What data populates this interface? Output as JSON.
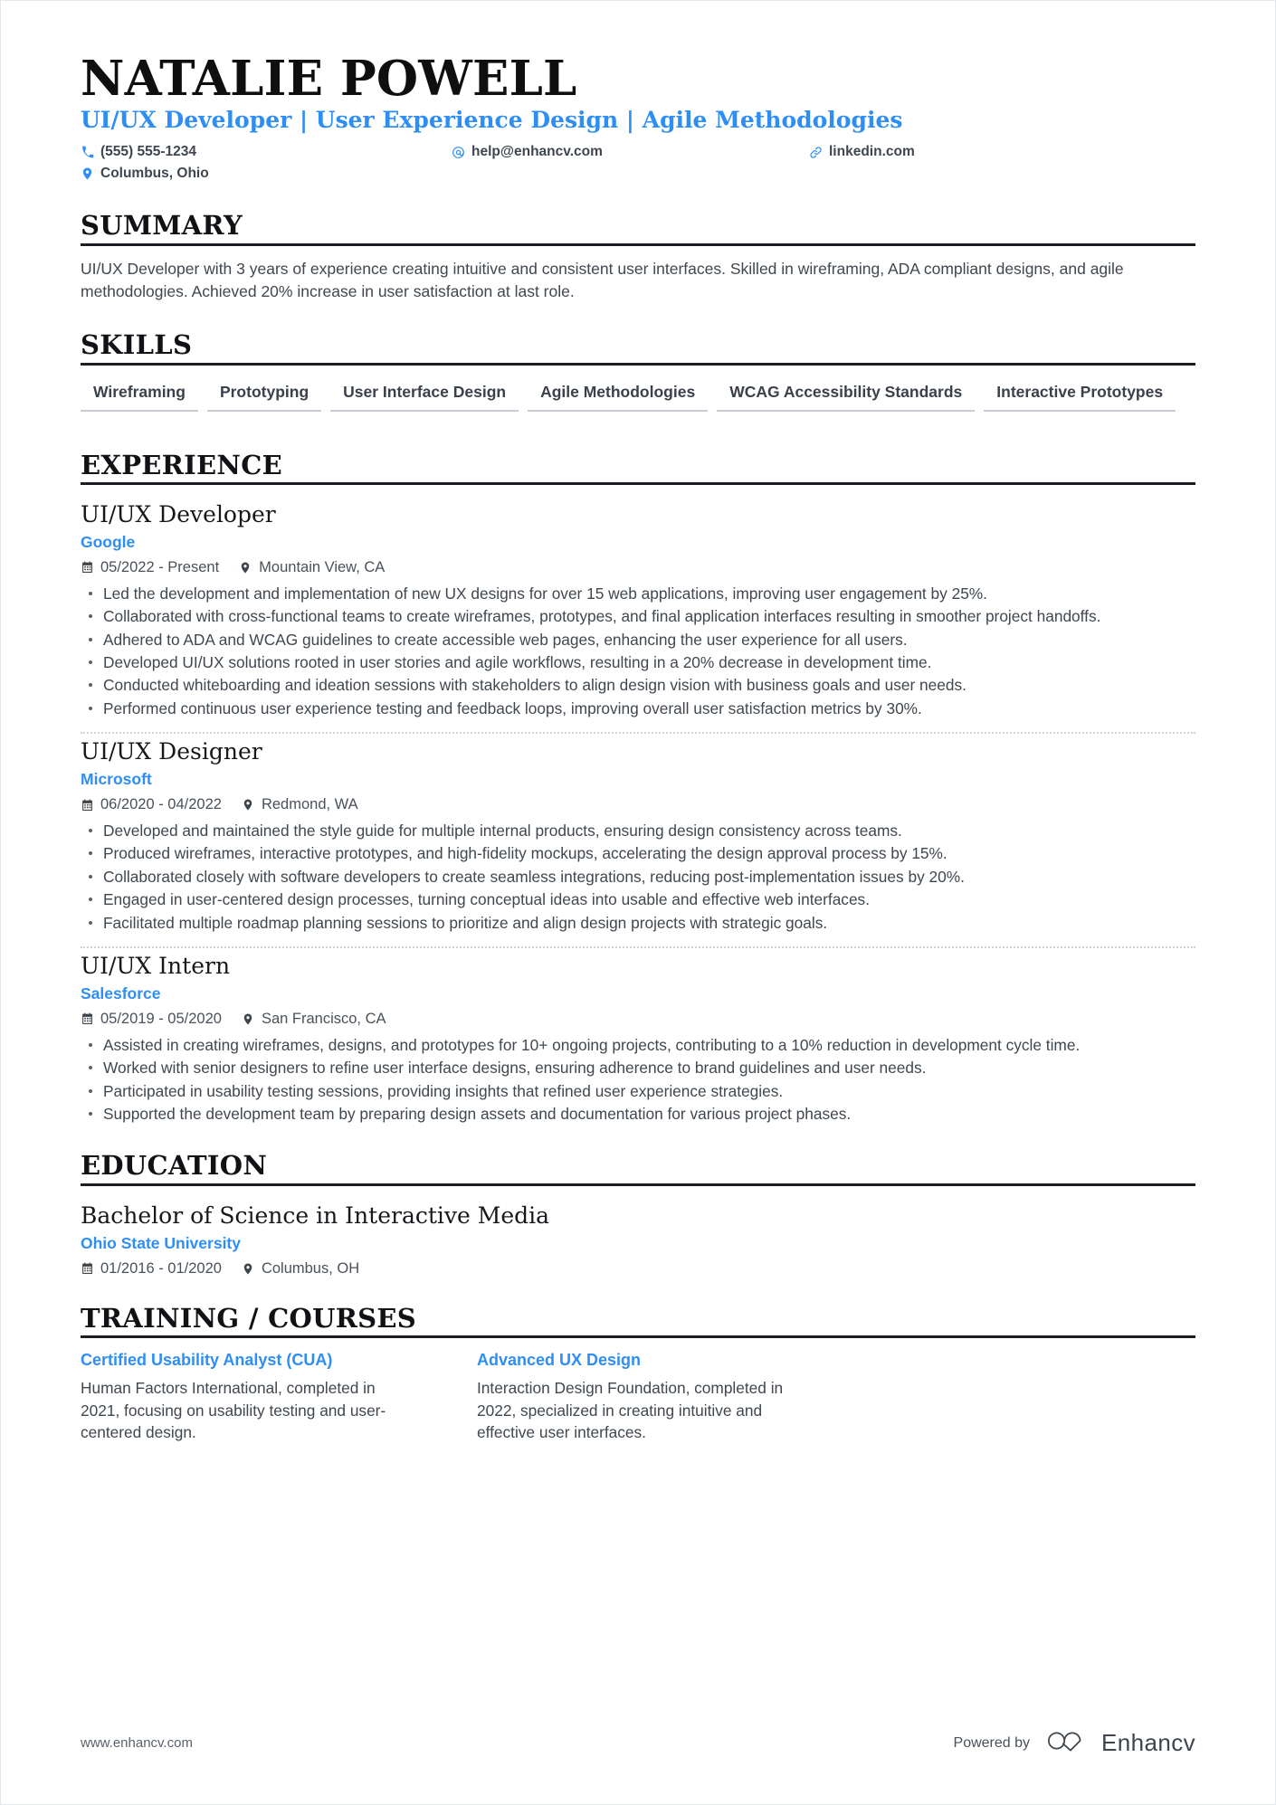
{
  "header": {
    "name": "NATALIE POWELL",
    "headline": "UI/UX Developer | User Experience Design | Agile Methodologies",
    "contacts": [
      {
        "icon": "phone-icon",
        "value": "(555) 555-1234"
      },
      {
        "icon": "email-icon",
        "value": "help@enhancv.com"
      },
      {
        "icon": "link-icon",
        "value": "linkedin.com"
      },
      {
        "icon": "location-icon",
        "value": "Columbus, Ohio"
      }
    ]
  },
  "sections": {
    "summary": {
      "title": "SUMMARY",
      "text": "UI/UX Developer with 3 years of experience creating intuitive and consistent user interfaces. Skilled in wireframing, ADA compliant designs, and agile methodologies. Achieved 20% increase in user satisfaction at last role."
    },
    "skills": {
      "title": "SKILLS",
      "items": [
        "Wireframing",
        "Prototyping",
        "User Interface Design",
        "Agile Methodologies",
        "WCAG Accessibility Standards",
        "Interactive Prototypes"
      ]
    },
    "experience": {
      "title": "EXPERIENCE",
      "entries": [
        {
          "title": "UI/UX Developer",
          "org": "Google",
          "dates": "05/2022 - Present",
          "location": "Mountain View, CA",
          "bullets": [
            "Led the development and implementation of new UX designs for over 15 web applications, improving user engagement by 25%.",
            "Collaborated with cross-functional teams to create wireframes, prototypes, and final application interfaces resulting in smoother project handoffs.",
            "Adhered to ADA and WCAG guidelines to create accessible web pages, enhancing the user experience for all users.",
            "Developed UI/UX solutions rooted in user stories and agile workflows, resulting in a 20% decrease in development time.",
            "Conducted whiteboarding and ideation sessions with stakeholders to align design vision with business goals and user needs.",
            "Performed continuous user experience testing and feedback loops, improving overall user satisfaction metrics by 30%."
          ]
        },
        {
          "title": "UI/UX Designer",
          "org": "Microsoft",
          "dates": "06/2020 - 04/2022",
          "location": "Redmond, WA",
          "bullets": [
            "Developed and maintained the style guide for multiple internal products, ensuring design consistency across teams.",
            "Produced wireframes, interactive prototypes, and high-fidelity mockups, accelerating the design approval process by 15%.",
            "Collaborated closely with software developers to create seamless integrations, reducing post-implementation issues by 20%.",
            "Engaged in user-centered design processes, turning conceptual ideas into usable and effective web interfaces.",
            "Facilitated multiple roadmap planning sessions to prioritize and align design projects with strategic goals."
          ]
        },
        {
          "title": "UI/UX Intern",
          "org": "Salesforce",
          "dates": "05/2019 - 05/2020",
          "location": "San Francisco, CA",
          "bullets": [
            "Assisted in creating wireframes, designs, and prototypes for 10+ ongoing projects, contributing to a 10% reduction in development cycle time.",
            "Worked with senior designers to refine user interface designs, ensuring adherence to brand guidelines and user needs.",
            "Participated in usability testing sessions, providing insights that refined user experience strategies.",
            "Supported the development team by preparing design assets and documentation for various project phases."
          ]
        }
      ]
    },
    "education": {
      "title": "EDUCATION",
      "entries": [
        {
          "degree": "Bachelor of Science in Interactive Media",
          "school": "Ohio State University",
          "dates": "01/2016 - 01/2020",
          "location": "Columbus, OH"
        }
      ]
    },
    "training": {
      "title": "TRAINING / COURSES",
      "courses": [
        {
          "name": "Certified Usability Analyst (CUA)",
          "description": "Human Factors International, completed in 2021, focusing on usability testing and user-centered design."
        },
        {
          "name": "Advanced UX Design",
          "description": "Interaction Design Foundation, completed in 2022, specialized in creating intuitive and effective user interfaces."
        }
      ]
    }
  },
  "footer": {
    "url": "www.enhancv.com",
    "powered_by": "Powered by",
    "brand": "Enhancv"
  },
  "colors": {
    "accent": "#2f8ef4",
    "text": "#40474f",
    "heading": "#111215",
    "rule": "#1a1d21",
    "skill_underline": "#c9ced4"
  }
}
